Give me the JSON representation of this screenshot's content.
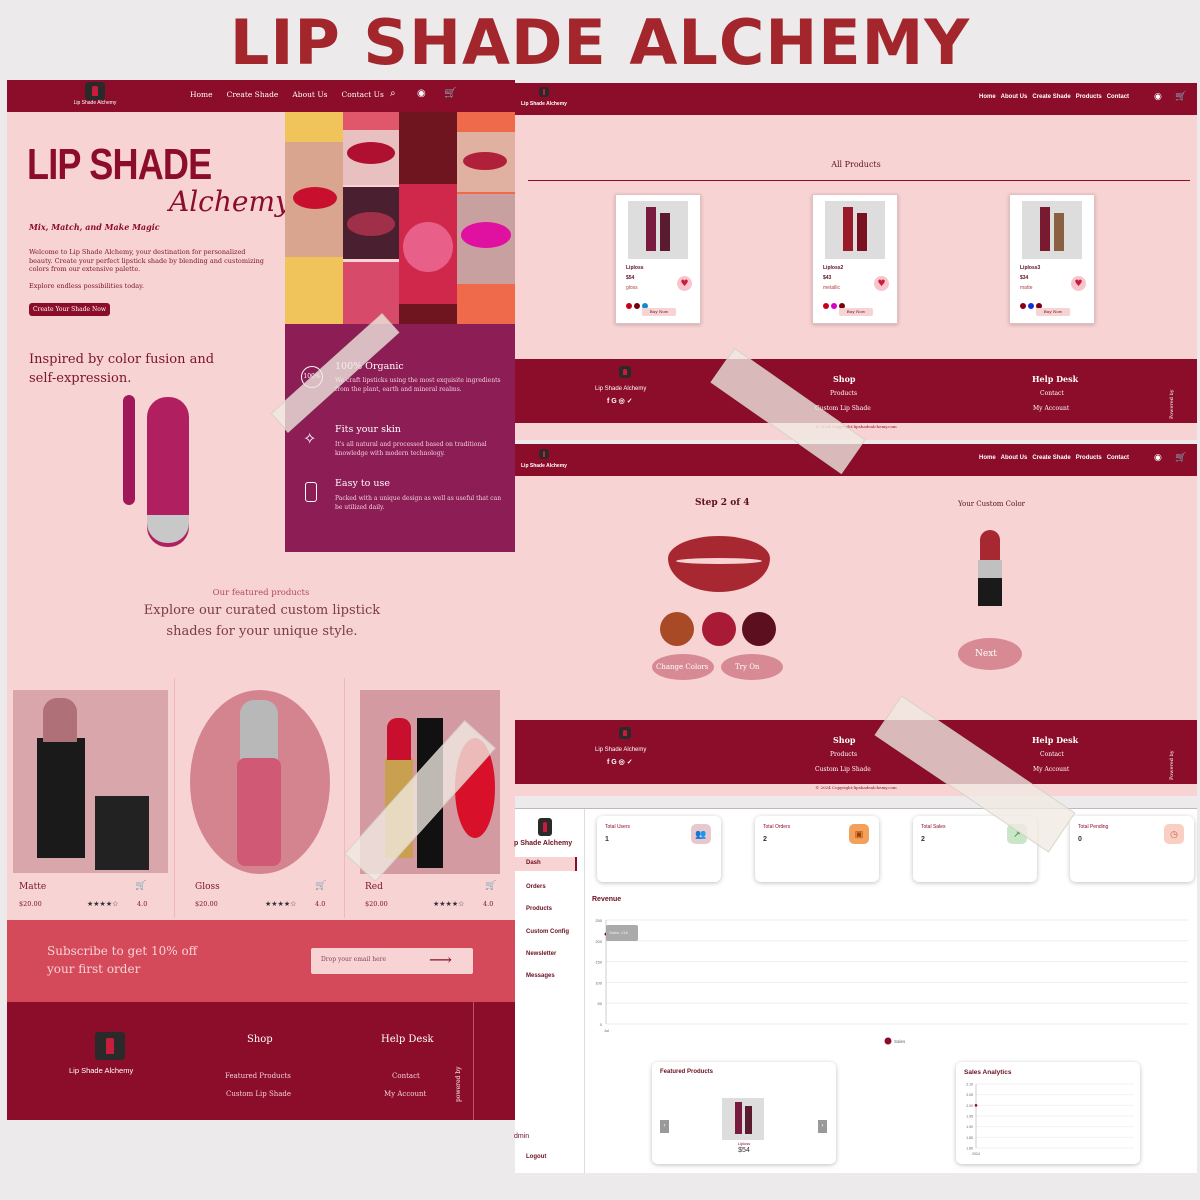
{
  "banner": {
    "title": "LIP SHADE ALCHEMY"
  },
  "brand": "Lip Shade Alchemy",
  "home": {
    "nav": [
      "Home",
      "Create Shade",
      "About Us",
      "Contact Us"
    ],
    "hero_title": "LIP SHADE",
    "hero_script": "Alchemy",
    "tagline": "Mix, Match, and Make Magic",
    "intro": "Welcome to Lip Shade Alchemy, your destination for personalized beauty. Create your perfect lipstick shade by blending and customizing colors from our extensive palette.",
    "explore": "Explore endless possibilities today.",
    "cta": "Create Your Shade Now",
    "inspired": "Inspired by color fusion and self-expression.",
    "features": [
      {
        "icon": "organic-icon",
        "title": "100% Organic",
        "text": "We craft lipsticks using the most exquisite ingredients from the plant, earth and mineral realms."
      },
      {
        "icon": "sparkle-icon",
        "title": "Fits your skin",
        "text": "It's all natural and processed based on traditional knowledge with modern technology."
      },
      {
        "icon": "bottle-icon",
        "title": "Easy to use",
        "text": "Packed with a unique design as well as useful that can be utilized daily."
      }
    ],
    "featured_kicker": "Our featured products",
    "featured_title": "Explore our curated custom lipstick shades for your unique style.",
    "products": [
      {
        "name": "Matte",
        "price": "$20.00",
        "rating": "4.0"
      },
      {
        "name": "Gloss",
        "price": "$20.00",
        "rating": "4.0"
      },
      {
        "name": "Red",
        "price": "$20.00",
        "rating": "4.0"
      }
    ],
    "subscribe": "Subscribe to get 10% off your first order",
    "email_placeholder": "Drop your email here",
    "footer": {
      "shop": "Shop",
      "shop_links": [
        "Featured Products",
        "Custom Lip Shade"
      ],
      "help": "Help Desk",
      "help_links": [
        "Contact",
        "My Account"
      ],
      "powered": "powered by"
    }
  },
  "products_page": {
    "nav": [
      "Home",
      "About Us",
      "Create Shade",
      "Products",
      "Contact"
    ],
    "title": "All Products",
    "items": [
      {
        "name": "Liploss",
        "price": "$54",
        "finish": "gloss",
        "button": "Buy Now",
        "colors": [
          "#c8001e",
          "#7a0010",
          "#0f8bd6"
        ]
      },
      {
        "name": "Liploss2",
        "price": "$43",
        "finish": "metallic",
        "button": "Buy Now",
        "colors": [
          "#c8001e",
          "#d600c8",
          "#7a0010"
        ]
      },
      {
        "name": "Liploss3",
        "price": "$34",
        "finish": "matte",
        "button": "Buy Now",
        "colors": [
          "#8b0010",
          "#1530d6",
          "#7a0010"
        ]
      }
    ]
  },
  "footer_small": {
    "shop": "Shop",
    "shop_links": [
      "Products",
      "Custom Lip Shade"
    ],
    "help": "Help Desk",
    "help_links": [
      "Contact",
      "My Account"
    ],
    "powered": "Powered by",
    "copyright": "© 2024 Copyright:lipshadealchemy.com"
  },
  "create_page": {
    "step": "Step 2 of 4",
    "custom": "Your Custom Color",
    "swatches": [
      "#a84a25",
      "#a81a35",
      "#5c0f1e"
    ],
    "change": "Change Colors",
    "try": "Try On",
    "next": "Next"
  },
  "dashboard": {
    "brand": "p Shade Alchemy",
    "menu": [
      "Dash",
      "Orders",
      "Products",
      "Custom Config",
      "Newsletter",
      "Messages"
    ],
    "admin": "dmin",
    "logout": "Logout",
    "stats": [
      {
        "label": "Total Users",
        "value": "1",
        "color": "#e8c8cc"
      },
      {
        "label": "Total Orders",
        "value": "2",
        "color": "#f2a05a"
      },
      {
        "label": "Total Sales",
        "value": "2",
        "color": "#c9e6c9"
      },
      {
        "label": "Total Pending",
        "value": "0",
        "color": "#f8cfc2"
      }
    ],
    "revenue": "Revenue",
    "legend": "Sales",
    "tooltip": "Sales: 216",
    "featured": "Featured Products",
    "feat_name": "Liploss",
    "feat_price": "$54",
    "analytics": "Sales Analytics",
    "analytics_year": "2024"
  },
  "chart_data": [
    {
      "type": "line",
      "title": "Revenue",
      "x": [
        "Jul"
      ],
      "series": [
        {
          "name": "Sales",
          "values": [
            216
          ]
        }
      ],
      "ylim": [
        0,
        250
      ],
      "yticks": [
        "250",
        "200",
        "150",
        "100",
        "50",
        "0"
      ]
    },
    {
      "type": "line",
      "title": "Sales Analytics",
      "x": [
        "2024"
      ],
      "series": [
        {
          "name": "Sales",
          "values": [
            2
          ]
        }
      ],
      "ylim": [
        1.8,
        2.1
      ],
      "yticks": [
        "2.10",
        "2.05",
        "2.00",
        "1.95",
        "1.90",
        "1.85",
        "1.80"
      ]
    }
  ]
}
